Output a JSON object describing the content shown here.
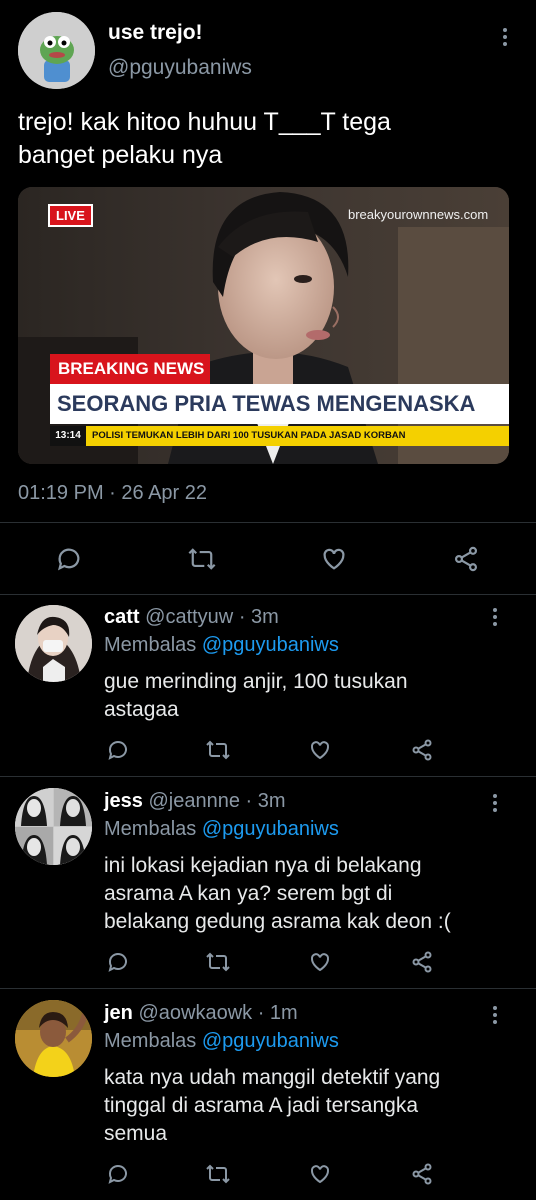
{
  "main_tweet": {
    "display_name": "use trejo!",
    "handle": "@pguyubaniws",
    "text_line1": "trejo! kak hitoo huhuu T___T tega",
    "text_line2": "banget pelaku nya",
    "timestamp": "01:19 PM · 26 Apr 22",
    "media": {
      "live_label": "LIVE",
      "watermark": "breakyourownnews.com",
      "breaking_label": "BREAKING NEWS",
      "headline": "SEORANG PRIA TEWAS MENGENASKA",
      "clock": "13:14",
      "ticker": "POLISI TEMUKAN LEBIH DARI 100 TUSUKAN PADA JASAD KORBAN"
    }
  },
  "replies": [
    {
      "name": "catt",
      "handle": "@cattyuw",
      "time": "· 3m",
      "replying_prefix": "Membalas",
      "replying_to": "@pguyubaniws",
      "lines": [
        "gue merinding anjir, 100 tusukan",
        "astagaa"
      ]
    },
    {
      "name": "jess",
      "handle": "@jeannne",
      "time": "· 3m",
      "replying_prefix": "Membalas",
      "replying_to": "@pguyubaniws",
      "lines": [
        "ini lokasi kejadian nya di belakang",
        "asrama A kan ya? serem bgt di",
        "belakang gedung asrama kak deon :("
      ]
    },
    {
      "name": "jen",
      "handle": "@aowkaowk",
      "time": "· 1m",
      "replying_prefix": "Membalas",
      "replying_to": "@pguyubaniws",
      "lines": [
        "kata nya udah manggil detektif yang",
        "tinggal di asrama A jadi tersangka",
        "semua"
      ]
    }
  ],
  "icons": [
    "reply-icon",
    "retweet-icon",
    "like-icon",
    "share-icon",
    "more-icon"
  ],
  "colors": {
    "accent": "#1d9bf0",
    "muted": "#8b98a5",
    "live_red": "#d8141c",
    "ticker_yellow": "#f4d000"
  }
}
